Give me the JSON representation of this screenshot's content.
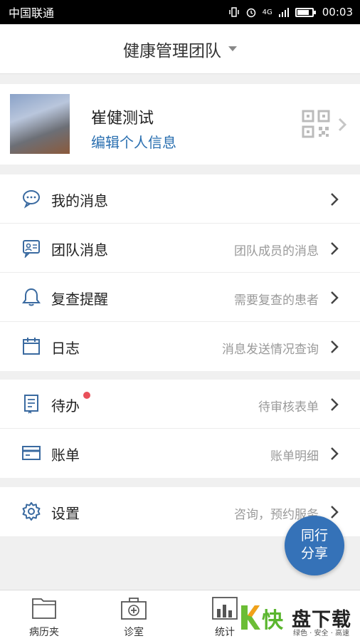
{
  "status_bar": {
    "carrier": "中国联通",
    "network": "4G",
    "time": "00:03"
  },
  "header": {
    "title": "健康管理团队"
  },
  "profile": {
    "name": "崔健测试",
    "edit_label": "编辑个人信息"
  },
  "menu_group_1": [
    {
      "label": "我的消息",
      "hint": "",
      "icon": "chat-bubble-icon"
    },
    {
      "label": "团队消息",
      "hint": "团队成员的消息",
      "icon": "team-message-icon"
    },
    {
      "label": "复查提醒",
      "hint": "需要复查的患者",
      "icon": "bell-icon"
    },
    {
      "label": "日志",
      "hint": "消息发送情况查询",
      "icon": "calendar-icon"
    }
  ],
  "menu_group_2": [
    {
      "label": "待办",
      "hint": "待审核表单",
      "icon": "todo-book-icon",
      "badge": true
    },
    {
      "label": "账单",
      "hint": "账单明细",
      "icon": "card-icon"
    }
  ],
  "menu_group_3": [
    {
      "label": "设置",
      "hint": "咨询，预约服务",
      "icon": "gear-icon"
    }
  ],
  "fab": {
    "line1": "同行",
    "line2": "分享"
  },
  "tabs": [
    {
      "label": "病历夹",
      "icon": "folder-icon"
    },
    {
      "label": "诊室",
      "icon": "clinic-icon"
    },
    {
      "label": "统计",
      "icon": "chart-icon"
    }
  ],
  "watermark": {
    "k": "K",
    "kuai": "快",
    "pan": "盘下载",
    "slogan": "绿色 · 安全 · 高速"
  },
  "colors": {
    "accent": "#2a6fb0",
    "fab": "#3572b8",
    "badge": "#e9505a",
    "icon": "#3a6aa0"
  }
}
